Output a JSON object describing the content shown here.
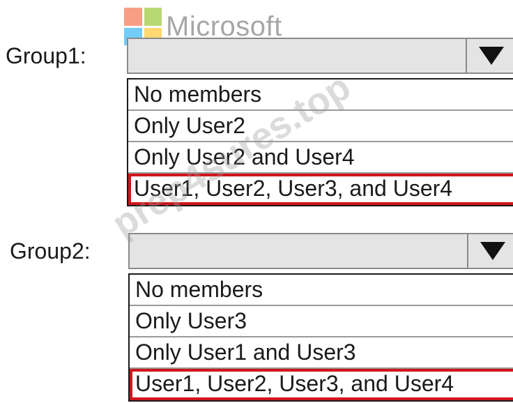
{
  "logo": {
    "name": "Microsoft"
  },
  "watermark": "prep4sures.top",
  "groups": [
    {
      "label": "Group1:",
      "options": [
        "No members",
        "Only User2",
        "Only User2 and User4",
        "User1, User2, User3, and User4"
      ],
      "selected_index": 3
    },
    {
      "label": "Group2:",
      "options": [
        "No members",
        "Only User3",
        "Only User1 and User3",
        "User1, User2, User3, and User4"
      ],
      "selected_index": 3
    }
  ],
  "colors": {
    "highlight": "#d0161c",
    "dropdown_bg": "#e4e4e4"
  }
}
